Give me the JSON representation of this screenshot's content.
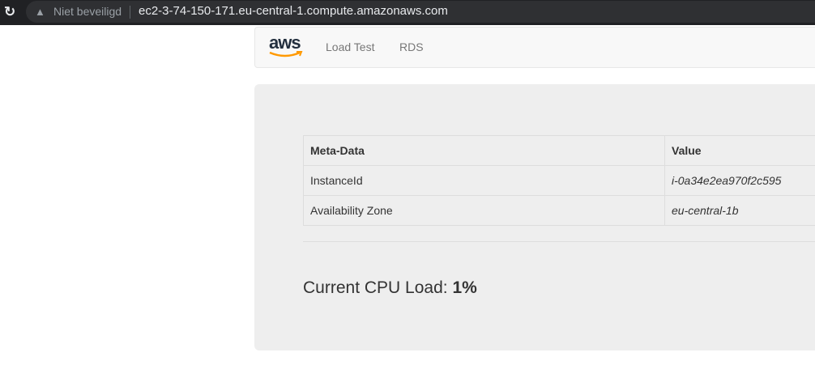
{
  "browser": {
    "security_label": "Niet beveiligd",
    "url": "ec2-3-74-150-171.eu-central-1.compute.amazonaws.com"
  },
  "navbar": {
    "logo": "aws",
    "links": [
      "Load Test",
      "RDS"
    ]
  },
  "table": {
    "headers": [
      "Meta-Data",
      "Value"
    ],
    "rows": [
      [
        "InstanceId",
        "i-0a34e2ea970f2c595"
      ],
      [
        "Availability Zone",
        "eu-central-1b"
      ]
    ]
  },
  "cpu": {
    "label": "Current CPU Load:",
    "value": "1%"
  },
  "colors": {
    "brand_orange": "#ff9900",
    "logo_dark": "#232f3e"
  }
}
